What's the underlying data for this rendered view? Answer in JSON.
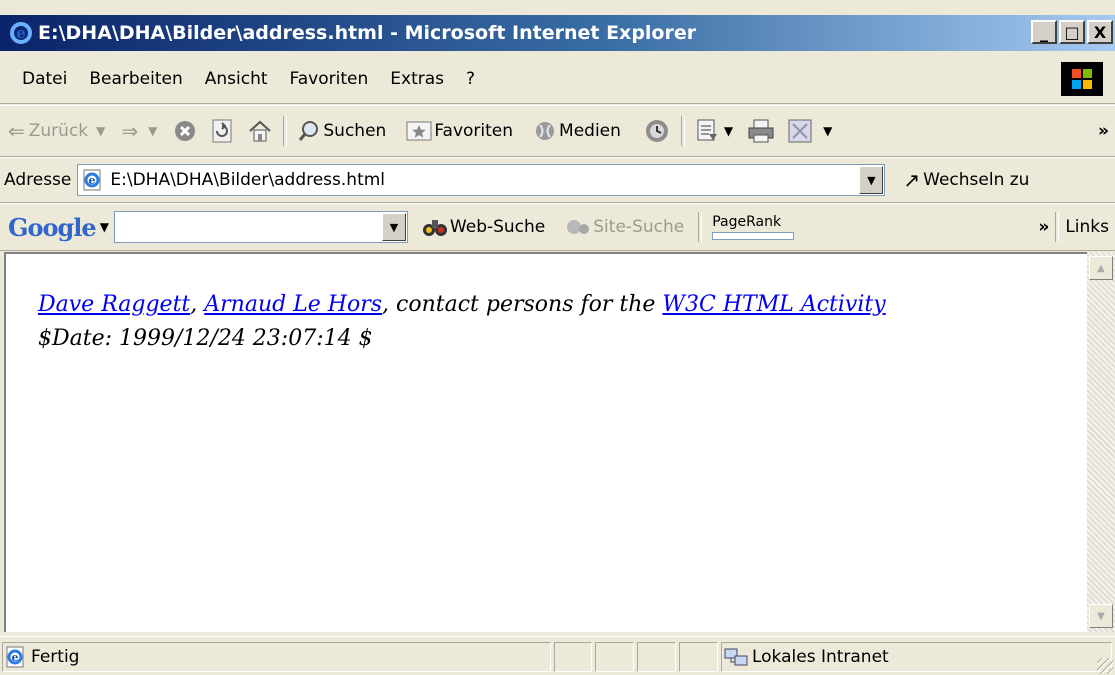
{
  "window": {
    "title": "E:\\DHA\\DHA\\Bilder\\address.html - Microsoft Internet Explorer",
    "buttons": {
      "minimize": "_",
      "maximize": "□",
      "close": "X"
    }
  },
  "menu": {
    "items": [
      "Datei",
      "Bearbeiten",
      "Ansicht",
      "Favoriten",
      "Extras",
      "?"
    ]
  },
  "toolbar": {
    "back": "Zurück",
    "search": "Suchen",
    "favorites": "Favoriten",
    "media": "Medien",
    "more": "»"
  },
  "address_bar": {
    "label": "Adresse",
    "url": "E:\\DHA\\DHA\\Bilder\\address.html",
    "go": "Wechseln zu"
  },
  "google_bar": {
    "logo": "Google",
    "web_search": "Web-Suche",
    "site_search": "Site-Suche",
    "pagerank": "PageRank",
    "more": "»",
    "links": "Links"
  },
  "page": {
    "link_1": "Dave Raggett",
    "sep_1": ", ",
    "link_2": "Arnaud Le Hors",
    "text_1": ", contact persons for the ",
    "link_3": "W3C HTML Activity",
    "date_line": "$Date: 1999/12/24 23:07:14 $"
  },
  "status_bar": {
    "status": "Fertig",
    "zone": "Lokales Intranet"
  },
  "colors": {
    "title_start": "#0a246a",
    "title_end": "#a6caf0",
    "link": "#0000ee",
    "chrome": "#ece9d8"
  }
}
